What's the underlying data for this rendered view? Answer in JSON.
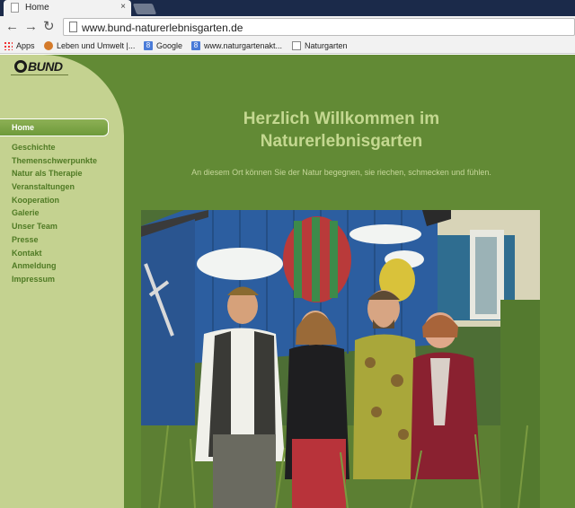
{
  "browser": {
    "tab_title": "Home",
    "tab_close": "×",
    "url": "www.bund-naturerlebnisgarten.de",
    "nav_back": "←",
    "nav_forward": "→",
    "nav_reload": "↻",
    "bookmarks": [
      {
        "label": "Apps",
        "icon": "apps-grid-icon"
      },
      {
        "label": "Leben und Umwelt |...",
        "icon": "globe-icon"
      },
      {
        "label": "Google",
        "icon": "google-icon"
      },
      {
        "label": "www.naturgartenakt...",
        "icon": "google-icon"
      },
      {
        "label": "Naturgarten",
        "icon": "page-icon"
      }
    ]
  },
  "site": {
    "logo_text": "BUND",
    "nav": [
      "Home",
      "Geschichte",
      "Themenschwerpunkte",
      "Natur als Therapie",
      "Veranstaltungen",
      "Kooperation",
      "Galerie",
      "Unser Team",
      "Presse",
      "Kontakt",
      "Anmeldung",
      "Impressum"
    ],
    "active_nav": "Home",
    "headline_line1": "Herzlich Willkommen im",
    "headline_line2": "Naturerlebnisgarten",
    "subline": "An diesem Ort können Sie der Natur begegnen, sie riechen, schmecken und fühlen.",
    "colors": {
      "page_bg": "#628a35",
      "sidebar_bg": "#c4d290",
      "nav_text": "#4f7a24",
      "headline": "#c4d890"
    }
  }
}
